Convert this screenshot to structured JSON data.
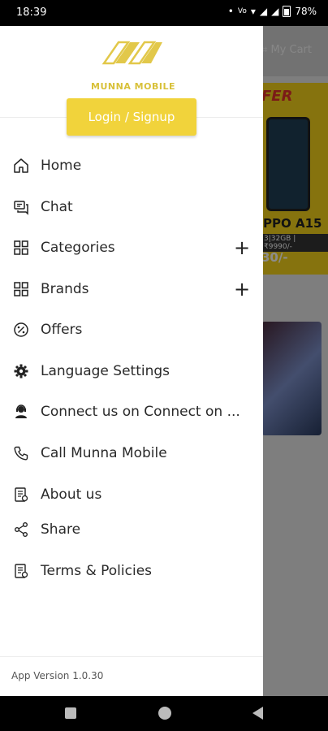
{
  "status_bar": {
    "time": "18:39",
    "battery": "78%"
  },
  "background_app": {
    "cart_label": "My Cart",
    "offer_text": "FER",
    "product_name": "PPO A15",
    "product_price": "3|32GB | ₹9990/-",
    "product_slab": "30/-"
  },
  "drawer": {
    "brand": "MUNNA MOBILE",
    "login_label": "Login / Signup",
    "menu": [
      {
        "label": "Home",
        "icon": "home-icon"
      },
      {
        "label": "Chat",
        "icon": "chat-icon"
      },
      {
        "label": "Categories",
        "icon": "grid-icon",
        "expandable": true
      },
      {
        "label": "Brands",
        "icon": "grid-icon",
        "expandable": true
      },
      {
        "label": "Offers",
        "icon": "percent-icon"
      },
      {
        "label": "Language Settings",
        "icon": "gear-icon"
      },
      {
        "label": "Connect us on Connect on ...",
        "icon": "support-agent-icon"
      },
      {
        "label": "Call Munna Mobile",
        "icon": "phone-icon"
      },
      {
        "label": "About us",
        "icon": "document-icon"
      },
      {
        "label": "Share",
        "icon": "share-icon"
      },
      {
        "label": "Terms & Policies",
        "icon": "policy-icon"
      }
    ],
    "version": "App Version 1.0.30"
  },
  "colors": {
    "accent": "#f1d33b",
    "brand_text": "#d8c13a"
  }
}
